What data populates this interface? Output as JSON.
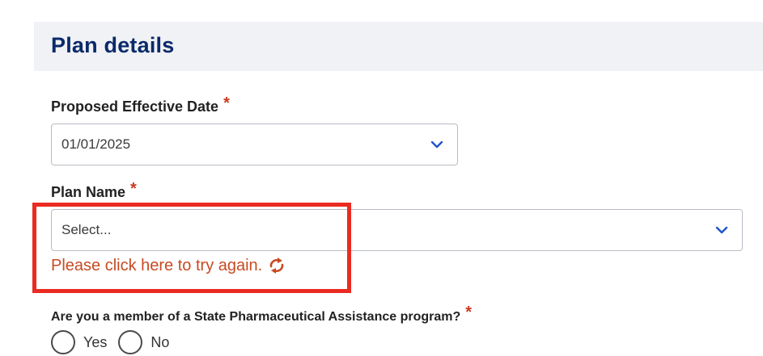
{
  "section": {
    "title": "Plan details"
  },
  "effective_date": {
    "label": "Proposed Effective Date",
    "required_mark": "*",
    "value": "01/01/2025"
  },
  "plan_name": {
    "label": "Plan Name",
    "required_mark": "*",
    "value": "Select...",
    "error_text": "Please click here to try again."
  },
  "spap_question": {
    "label": "Are you a member of a State Pharmaceutical Assistance program?",
    "required_mark": "*",
    "options": [
      {
        "label": "Yes",
        "selected": false
      },
      {
        "label": "No",
        "selected": false
      }
    ]
  },
  "colors": {
    "title": "#0b2a6b",
    "required": "#c93a1f",
    "error": "#c84a22",
    "highlight": "#ea2b22",
    "chevron": "#1e55c8",
    "header_bg": "#f1f2f5"
  },
  "icons": {
    "dropdown": "chevron-down-icon",
    "retry": "refresh-icon"
  }
}
